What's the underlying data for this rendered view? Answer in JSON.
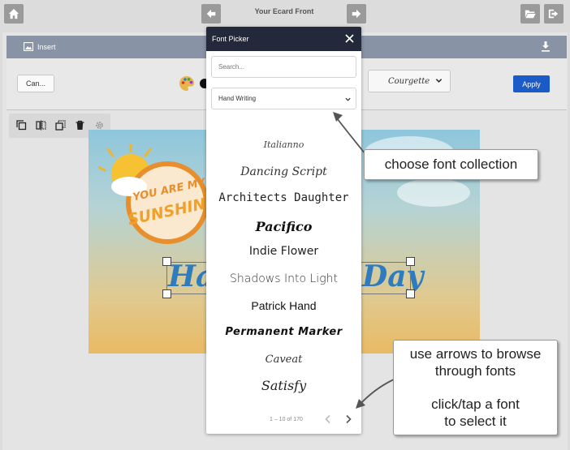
{
  "topbar": {
    "title": "Your Ecard Front",
    "icons": [
      "home-icon",
      "arrow-left-icon",
      "arrow-right-icon",
      "folder-open-icon",
      "sign-out-icon"
    ]
  },
  "insertbar": {
    "insert_label": "Insert",
    "icons": [
      "image-icon",
      "download-icon"
    ]
  },
  "fontbar": {
    "cancel_label": "Can...",
    "current_font": "Courgette",
    "apply_label": "Apply",
    "icons": [
      "palette-icon",
      "chevron-down-icon"
    ]
  },
  "tools": {
    "icons": [
      "copy-icon",
      "flip-icon",
      "layers-icon",
      "trash-icon",
      "gear-icon"
    ]
  },
  "card": {
    "sticker_line1": "YOU ARE MY",
    "sticker_line2": "SUNSHINE",
    "text_left": "Ha",
    "text_right": "Day"
  },
  "picker": {
    "title": "Font Picker",
    "search_placeholder": "Search...",
    "collection": "Hand Writing",
    "fonts": [
      "Italianno",
      "Dancing Script",
      "Architects Daughter",
      "Pacifico",
      "Indie Flower",
      "Shadows Into Light",
      "Patrick Hand",
      "Permanent Marker",
      "Caveat",
      "Satisfy"
    ],
    "pager": "1 – 10 of 170"
  },
  "callouts": {
    "collection": "choose font collection",
    "browse_line1": "use arrows to browse",
    "browse_line2": "through fonts",
    "select_line1": "click/tap a font",
    "select_line2": "to select it"
  },
  "colors": {
    "header": "#23293a",
    "apply": "#1a5bc7",
    "insertbar": "#8993a6",
    "sun": "#f0b52e",
    "text_blue": "#2e7bbd"
  }
}
